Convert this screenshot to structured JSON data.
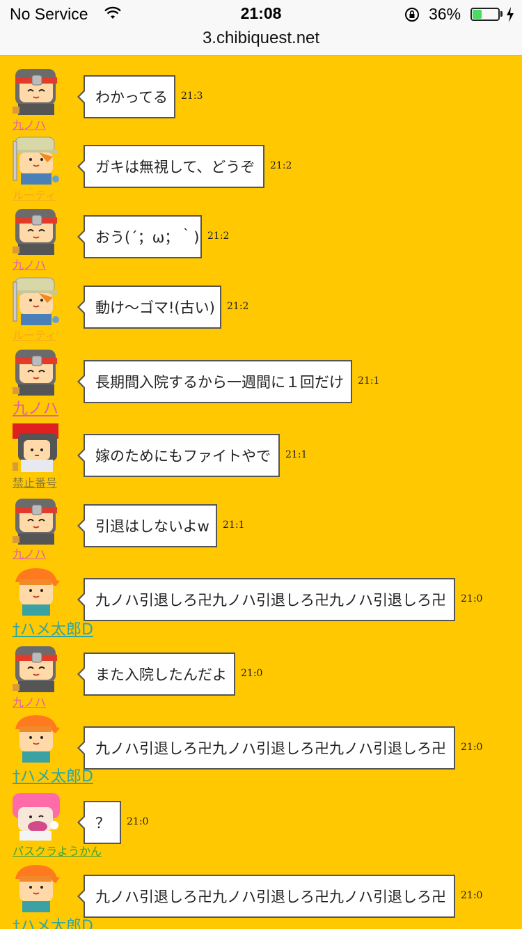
{
  "status_bar": {
    "carrier": "No Service",
    "time": "21:08",
    "battery_percent": "36%",
    "battery_level": 0.36
  },
  "url_bar": {
    "url": "3.chibiquest.net"
  },
  "colors": {
    "background": "#ffc800",
    "name_pink": "#e05cb0",
    "name_orange": "#f5a623",
    "name_olive": "#8a7a3a",
    "name_teal": "#2ea6a6",
    "name_green": "#3aa23a"
  },
  "chat": {
    "messages": [
      {
        "user": "九ノハ",
        "avatar": "ninja-avatar-icon",
        "text": "わかってる",
        "time": "21:3"
      },
      {
        "user": "ルーティ",
        "avatar": "explorer-avatar-icon",
        "text": "ガキは無視して、どうぞ",
        "time": "21:2"
      },
      {
        "user": "九ノハ",
        "avatar": "ninja-avatar-icon",
        "text": "おう(´；ω；｀)",
        "time": "21:2"
      },
      {
        "user": "ルーティ",
        "avatar": "explorer-avatar-icon",
        "text": "動け〜ゴマ!(古い)",
        "time": "21:2"
      },
      {
        "user": "九ノハ",
        "avatar": "ninja-avatar-icon",
        "text": "長期間入院するから一週間に１回だけ",
        "time": "21:1"
      },
      {
        "user": "禁止番号",
        "avatar": "red-hat-avatar-icon",
        "text": "嫁のためにもファイトやで",
        "time": "21:1"
      },
      {
        "user": "九ノハ",
        "avatar": "ninja-avatar-icon",
        "text": "引退はしないよw",
        "time": "21:1"
      },
      {
        "user": "†ハメ太郎D",
        "avatar": "orange-cap-avatar-icon",
        "text": "九ノハ引退しろ卍九ノハ引退しろ卍九ノハ引退しろ卍",
        "time": "21:0"
      },
      {
        "user": "九ノハ",
        "avatar": "ninja-avatar-icon",
        "text": "また入院したんだよ",
        "time": "21:0"
      },
      {
        "user": "†ハメ太郎D",
        "avatar": "orange-cap-avatar-icon",
        "text": "九ノハ引退しろ卍九ノハ引退しろ卍九ノハ引退しろ卍",
        "time": "21:0"
      },
      {
        "user": "パスクラようかん",
        "avatar": "pink-hair-avatar-icon",
        "text": "？",
        "time": "21:0"
      },
      {
        "user": "†ハメ太郎D",
        "avatar": "orange-cap-avatar-icon",
        "text": "九ノハ引退しろ卍九ノハ引退しろ卍九ノハ引退しろ卍",
        "time": "21:0"
      }
    ]
  }
}
